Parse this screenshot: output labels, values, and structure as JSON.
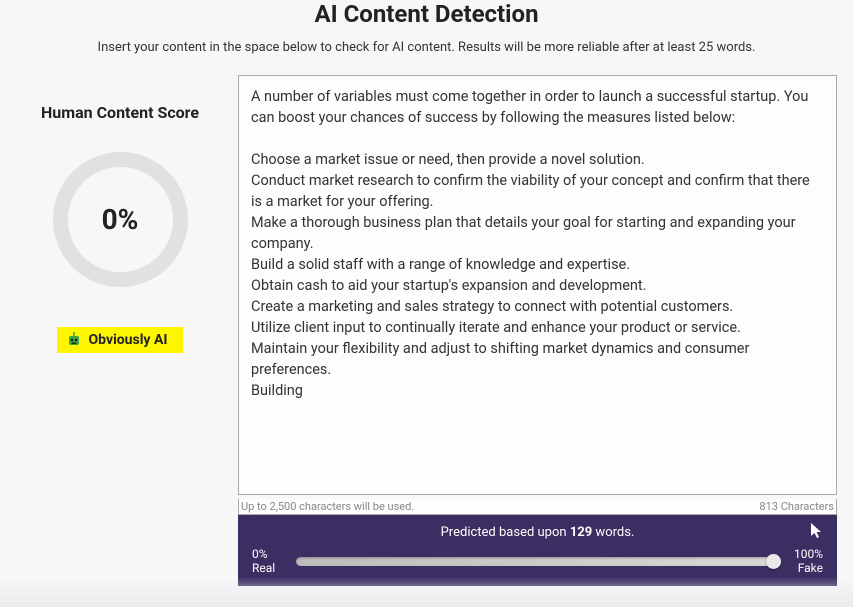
{
  "header": {
    "title": "AI Content Detection",
    "subtitle": "Insert your content in the space below to check for AI content. Results will be more reliable after at least 25 words."
  },
  "score": {
    "title": "Human Content Score",
    "value": "0%"
  },
  "badge": {
    "label": "Obviously AI"
  },
  "input": {
    "value": "A number of variables must come together in order to launch a successful startup. You can boost your chances of success by following the measures listed below:\n\nChoose a market issue or need, then provide a novel solution.\nConduct market research to confirm the viability of your concept and confirm that there is a market for your offering.\nMake a thorough business plan that details your goal for starting and expanding your company.\nBuild a solid staff with a range of knowledge and expertise.\nObtain cash to aid your startup's expansion and development.\nCreate a marketing and sales strategy to connect with potential customers.\nUtilize client input to continually iterate and enhance your product or service.\nMaintain your flexibility and adjust to shifting market dynamics and consumer preferences.\nBuilding",
    "hint_left": "Up to 2,500 characters will be used.",
    "hint_right": "813 Characters"
  },
  "result": {
    "predicted_prefix": "Predicted based upon ",
    "predicted_count": "129",
    "predicted_suffix": " words.",
    "left_pct": "0%",
    "left_label": "Real",
    "right_pct": "100%",
    "right_label": "Fake"
  }
}
